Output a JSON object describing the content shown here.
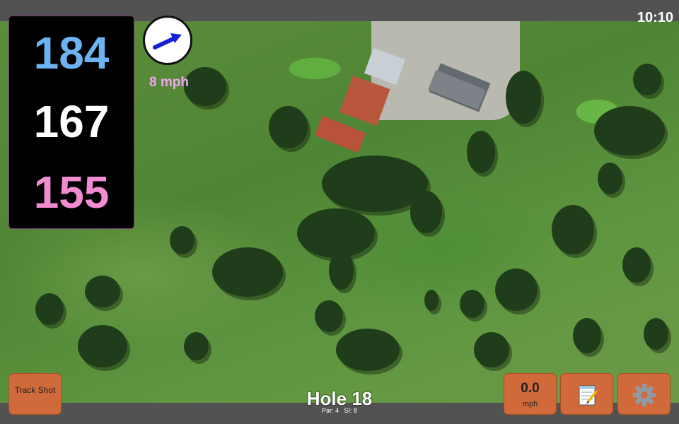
{
  "status": {
    "time": "10:10"
  },
  "yardages": {
    "back": "184",
    "middle": "167",
    "front": "155"
  },
  "wind": {
    "speed": "8 mph",
    "direction_icon": "arrow-icon"
  },
  "buttons": {
    "track_shot": "Track Shot",
    "speed_value": "0.0",
    "speed_unit": "mph",
    "notes_icon": "notepad-icon",
    "settings_icon": "gear-icon"
  },
  "hole": {
    "title": "Hole 18",
    "par": "Par: 4",
    "si": "SI: 8"
  },
  "colors": {
    "back": "#6db3f2",
    "middle": "#ffffff",
    "front": "#f08ccf",
    "button": "#d06a3a",
    "wind_text": "#f0a8ef"
  }
}
